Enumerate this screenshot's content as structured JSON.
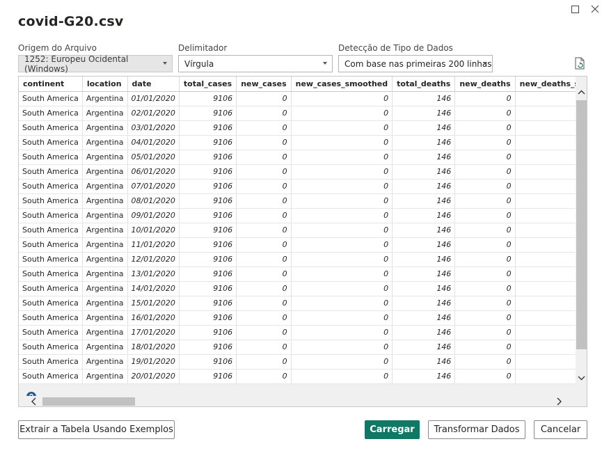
{
  "window": {
    "title": "covid-G20.csv"
  },
  "options": {
    "file_origin": {
      "label": "Origem do Arquivo",
      "value": "1252: Europeu Ocidental (Windows)"
    },
    "delimiter": {
      "label": "Delimitador",
      "value": "Vírgula"
    },
    "type_detection": {
      "label": "Detecção de Tipo de Dados",
      "value": "Com base nas primeiras 200 linhas"
    }
  },
  "table": {
    "columns": [
      "continent",
      "location",
      "date",
      "total_cases",
      "new_cases",
      "new_cases_smoothed",
      "total_deaths",
      "new_deaths",
      "new_deaths_smoothe"
    ],
    "rows": [
      [
        "South America",
        "Argentina",
        "01/01/2020",
        "9106",
        "0",
        "0",
        "146",
        "0",
        ""
      ],
      [
        "South America",
        "Argentina",
        "02/01/2020",
        "9106",
        "0",
        "0",
        "146",
        "0",
        ""
      ],
      [
        "South America",
        "Argentina",
        "03/01/2020",
        "9106",
        "0",
        "0",
        "146",
        "0",
        ""
      ],
      [
        "South America",
        "Argentina",
        "04/01/2020",
        "9106",
        "0",
        "0",
        "146",
        "0",
        ""
      ],
      [
        "South America",
        "Argentina",
        "05/01/2020",
        "9106",
        "0",
        "0",
        "146",
        "0",
        ""
      ],
      [
        "South America",
        "Argentina",
        "06/01/2020",
        "9106",
        "0",
        "0",
        "146",
        "0",
        ""
      ],
      [
        "South America",
        "Argentina",
        "07/01/2020",
        "9106",
        "0",
        "0",
        "146",
        "0",
        ""
      ],
      [
        "South America",
        "Argentina",
        "08/01/2020",
        "9106",
        "0",
        "0",
        "146",
        "0",
        ""
      ],
      [
        "South America",
        "Argentina",
        "09/01/2020",
        "9106",
        "0",
        "0",
        "146",
        "0",
        ""
      ],
      [
        "South America",
        "Argentina",
        "10/01/2020",
        "9106",
        "0",
        "0",
        "146",
        "0",
        ""
      ],
      [
        "South America",
        "Argentina",
        "11/01/2020",
        "9106",
        "0",
        "0",
        "146",
        "0",
        ""
      ],
      [
        "South America",
        "Argentina",
        "12/01/2020",
        "9106",
        "0",
        "0",
        "146",
        "0",
        ""
      ],
      [
        "South America",
        "Argentina",
        "13/01/2020",
        "9106",
        "0",
        "0",
        "146",
        "0",
        ""
      ],
      [
        "South America",
        "Argentina",
        "14/01/2020",
        "9106",
        "0",
        "0",
        "146",
        "0",
        ""
      ],
      [
        "South America",
        "Argentina",
        "15/01/2020",
        "9106",
        "0",
        "0",
        "146",
        "0",
        ""
      ],
      [
        "South America",
        "Argentina",
        "16/01/2020",
        "9106",
        "0",
        "0",
        "146",
        "0",
        ""
      ],
      [
        "South America",
        "Argentina",
        "17/01/2020",
        "9106",
        "0",
        "0",
        "146",
        "0",
        ""
      ],
      [
        "South America",
        "Argentina",
        "18/01/2020",
        "9106",
        "0",
        "0",
        "146",
        "0",
        ""
      ],
      [
        "South America",
        "Argentina",
        "19/01/2020",
        "9106",
        "0",
        "0",
        "146",
        "0",
        ""
      ],
      [
        "South America",
        "Argentina",
        "20/01/2020",
        "9106",
        "0",
        "0",
        "146",
        "0",
        ""
      ]
    ]
  },
  "buttons": {
    "extract": "Extrair a Tabela Usando Exemplos",
    "load": "Carregar",
    "transform": "Transformar Dados",
    "cancel": "Cancelar"
  },
  "colors": {
    "primary": "#117865",
    "scroll_thumb": "#c1c1c1"
  },
  "icons": [
    "maximize-icon",
    "close-icon",
    "chevron-down-icon",
    "refresh-file-icon",
    "chevron-up-icon",
    "chevron-left-icon",
    "chevron-right-icon",
    "help-icon"
  ]
}
